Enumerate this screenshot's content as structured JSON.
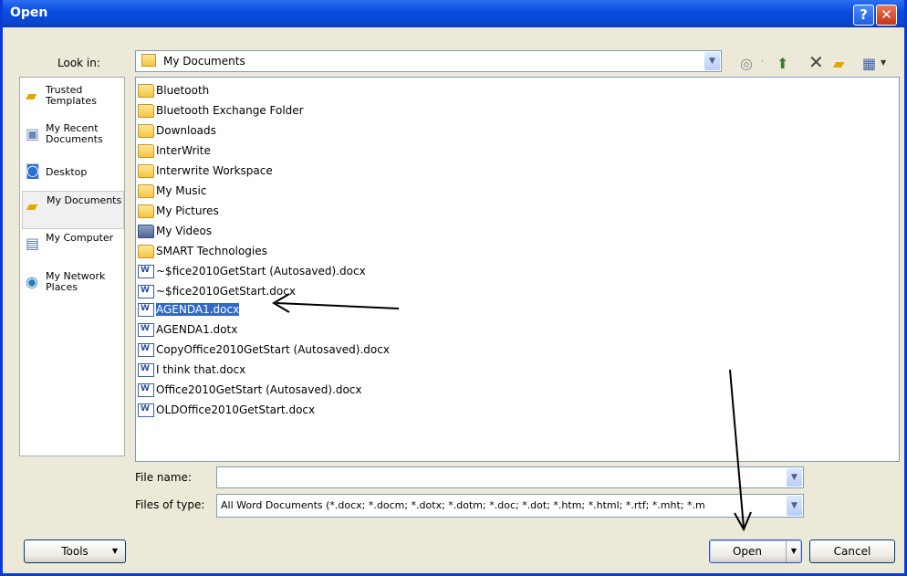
{
  "window": {
    "title": "Open",
    "help": "?",
    "close": "✕"
  },
  "lookin": {
    "label": "Look in:",
    "value": "My Documents"
  },
  "places": [
    {
      "label": "Trusted Templates"
    },
    {
      "label": "My Recent Documents"
    },
    {
      "label": "Desktop"
    },
    {
      "label": "My Documents"
    },
    {
      "label": "My Computer"
    },
    {
      "label": "My Network Places"
    }
  ],
  "files": [
    {
      "name": "Bluetooth"
    },
    {
      "name": "Bluetooth Exchange Folder"
    },
    {
      "name": "Downloads"
    },
    {
      "name": "InterWrite"
    },
    {
      "name": "Interwrite Workspace"
    },
    {
      "name": "My Music"
    },
    {
      "name": "My Pictures"
    },
    {
      "name": "My Videos"
    },
    {
      "name": "SMART Technologies"
    },
    {
      "name": "~$fice2010GetStart (Autosaved).docx"
    },
    {
      "name": "~$fice2010GetStart.docx"
    },
    {
      "name": "AGENDA1.docx"
    },
    {
      "name": "AGENDA1.dotx"
    },
    {
      "name": "CopyOffice2010GetStart (Autosaved).docx"
    },
    {
      "name": "I think that.docx"
    },
    {
      "name": "Office2010GetStart (Autosaved).docx"
    },
    {
      "name": "OLDOffice2010GetStart.docx"
    }
  ],
  "filename": {
    "label": "File name:",
    "value": ""
  },
  "filetype": {
    "label": "Files of type:",
    "value": "All Word Documents (*.docx; *.docm; *.dotx; *.dotm; *.doc; *.dot; *.htm; *.html; *.rtf; *.mht; *.m"
  },
  "buttons": {
    "tools": "Tools",
    "open": "Open",
    "cancel": "Cancel"
  }
}
